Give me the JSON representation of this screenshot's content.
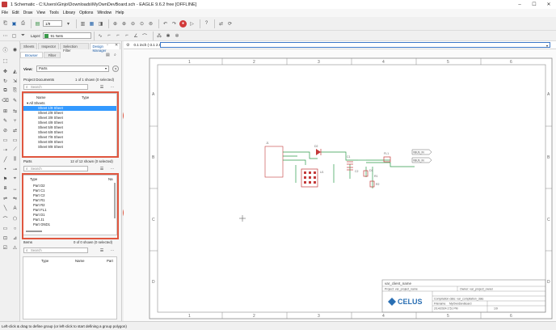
{
  "window": {
    "title": "1 Schematic - C:\\Users\\Ginjo\\Downloads\\MyOwnDevBoard.sch - EAGLE 9.6.2 free [OFFLINE]",
    "controls": [
      "–",
      "☐",
      "✕"
    ]
  },
  "menu": [
    "File",
    "Edit",
    "Draw",
    "View",
    "Tools",
    "Library",
    "Options",
    "Window",
    "Help"
  ],
  "toolbar": {
    "sheet_selector": "1/9"
  },
  "layer": {
    "label": "Layer:",
    "value": "91 Nets",
    "color": "#3a9a4a"
  },
  "coordinates": {
    "readout": "0.1 inch (-3.1 2.6)"
  },
  "panel": {
    "tabs": [
      "Sheets",
      "Inspector",
      "Selection Filter",
      "Design Manager"
    ],
    "active_tab": "Design Manager",
    "subtabs": [
      "Browser",
      "Filter"
    ],
    "active_subtab": "Browser",
    "view_label": "View:",
    "view_value": "Parts",
    "help": "?",
    "project_docs": {
      "title": "Project Documents",
      "count": "1 of 1 shown (0 selected)",
      "search_placeholder": "Search",
      "col_name": "Name",
      "col_type": "Type",
      "root": "All Sheets",
      "rows": [
        "Sheet 1/9 Sheet",
        "Sheet 2/9 Sheet",
        "Sheet 3/9 Sheet",
        "Sheet 4/9 Sheet",
        "Sheet 5/9 Sheet",
        "Sheet 6/9 Sheet",
        "Sheet 7/9 Sheet",
        "Sheet 8/9 Sheet",
        "Sheet 9/9 Sheet"
      ]
    },
    "parts": {
      "title": "Parts",
      "count": "12 of 12 shown (0 selected)",
      "search_placeholder": "Search",
      "col_type": "Type",
      "col_na": "Na",
      "rows": [
        "Part D2",
        "Part C1",
        "Part C2",
        "Part R1",
        "Part R2",
        "Part FL1",
        "Part D1",
        "Part J1",
        "Part GND1"
      ]
    },
    "items": {
      "title": "Items",
      "count": "0 of 0 shown (0 selected)",
      "search_placeholder": "Search",
      "col_type": "Type",
      "col_name": "Name",
      "col_part": "Part"
    }
  },
  "callouts": [
    "1",
    "2"
  ],
  "callout_color": "#e0563f",
  "schematic": {
    "frame_cols": [
      "1",
      "2",
      "3",
      "4",
      "5",
      "6"
    ],
    "frame_rows": [
      "A",
      "B",
      "C",
      "D"
    ],
    "title_block": {
      "title": "var_client_name",
      "project": "Project: var_project_name",
      "owner": "Owner: var_project_owner",
      "compilation": "Compilation date: var_compilation_date",
      "filename_label": "Filename",
      "filename": "MyOwnDevBoard",
      "date": "2/14/2024 2:51 PM",
      "sheet": "1/9",
      "brand": "CELUS"
    },
    "net_labels": [
      "VBUS_IN",
      "VBUS_IN"
    ],
    "part_labels": [
      "J1",
      "D2",
      "U1",
      "C1",
      "C2",
      "FL1",
      "D1",
      "R1",
      "R2"
    ],
    "connector_text": "CONN\nVBUS\nD-\nD+\nID\nGND\nSHIELD"
  },
  "status": {
    "text": "Left-click & drag to define group (or left-click to start defining a group polygon)"
  }
}
